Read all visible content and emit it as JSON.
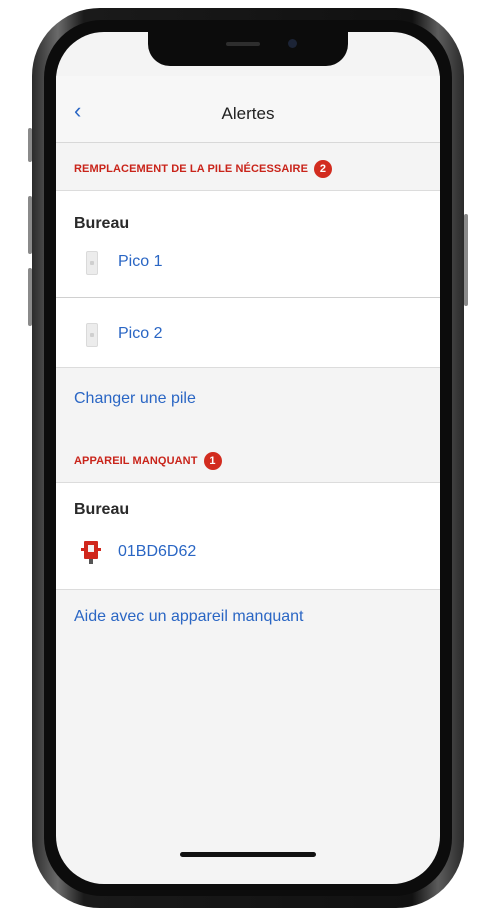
{
  "nav": {
    "back_icon": "chevron-left-icon",
    "title": "Alertes"
  },
  "battery_section": {
    "header": "REMPLACEMENT DE LA PILE NÉCESSAIRE",
    "badge": "2",
    "room": "Bureau",
    "devices": [
      {
        "label": "Pico 1",
        "icon": "pico-remote-icon"
      },
      {
        "label": "Pico 2",
        "icon": "pico-remote-icon"
      }
    ],
    "link": "Changer une pile"
  },
  "missing_section": {
    "header": "APPAREIL MANQUANT",
    "badge": "1",
    "room": "Bureau",
    "device": {
      "label": "01BD6D62",
      "icon": "bridge-device-icon"
    },
    "link": "Aide avec un appareil manquant"
  },
  "colors": {
    "accent": "#2a66c4",
    "alert": "#c9241a",
    "badge": "#d22c1f"
  }
}
